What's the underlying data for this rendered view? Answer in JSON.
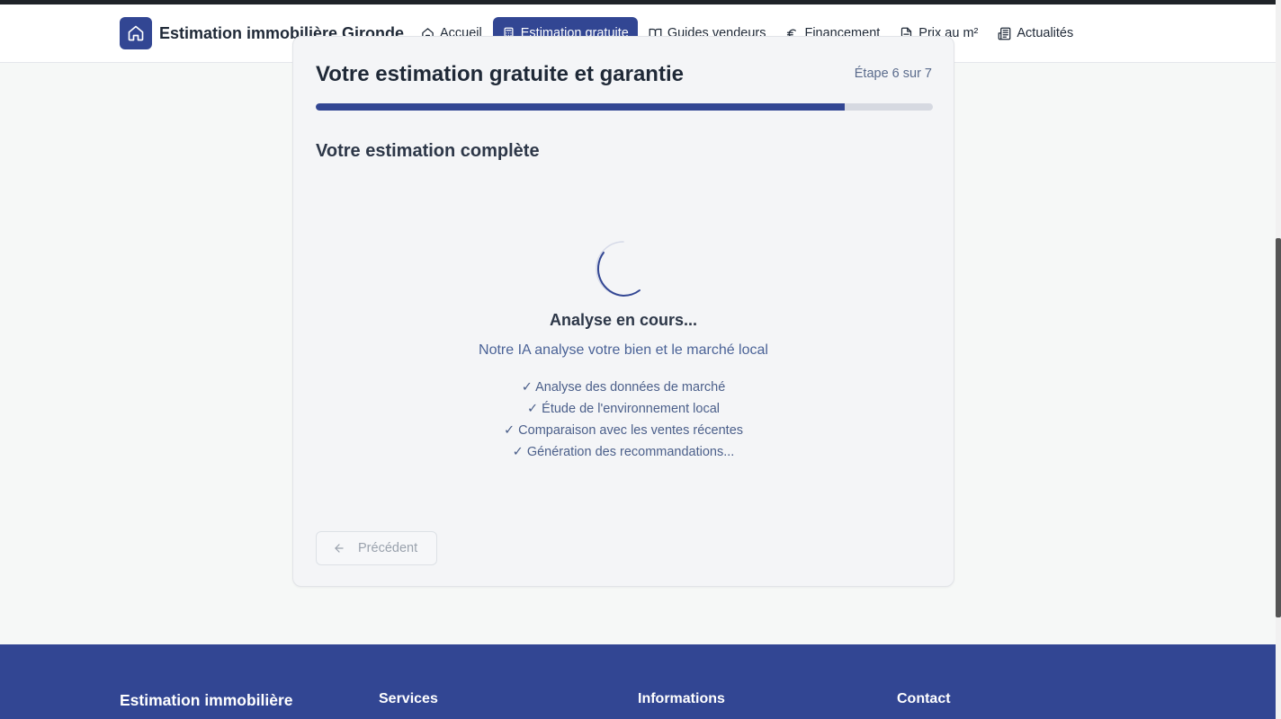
{
  "header": {
    "brand": "Estimation immobilière Gironde",
    "nav": [
      {
        "label": "Accueil",
        "icon": "home-icon",
        "active": false
      },
      {
        "label": "Estimation gratuite",
        "icon": "calculator-icon",
        "active": true
      },
      {
        "label": "Guides vendeurs",
        "icon": "book-icon",
        "active": false
      },
      {
        "label": "Financement",
        "icon": "euro-icon",
        "active": false
      },
      {
        "label": "Prix au m²",
        "icon": "document-icon",
        "active": false
      },
      {
        "label": "Actualités",
        "icon": "newspaper-icon",
        "active": false
      }
    ]
  },
  "form": {
    "title": "Votre estimation gratuite et garantie",
    "step": "Étape 6 sur 7",
    "progress_fraction": 0.857,
    "section_title": "Votre estimation complète",
    "loading": {
      "title": "Analyse en cours...",
      "subtitle": "Notre IA analyse votre bien et le marché local",
      "steps": [
        "✓ Analyse des données de marché",
        "✓ Étude de l'environnement local",
        "✓ Comparaison avec les ventes récentes",
        "✓ Génération des recommandations..."
      ]
    },
    "prev_label": "Précédent"
  },
  "footer": {
    "brand": "Estimation immobilière",
    "col_services": "Services",
    "col_informations": "Informations",
    "col_contact": "Contact"
  },
  "colors": {
    "primary": "#324693",
    "background": "#f6f8f7"
  }
}
